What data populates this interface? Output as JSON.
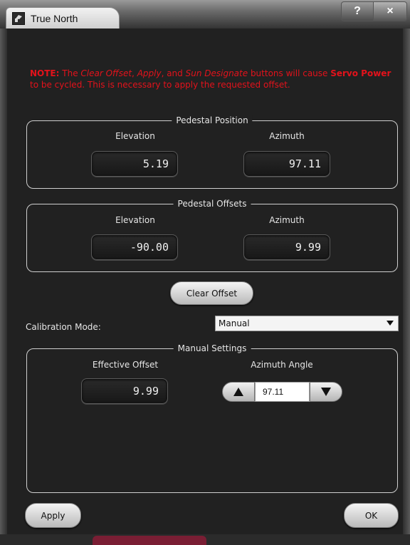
{
  "window": {
    "title": "True North",
    "help_label": "?",
    "close_label": "×",
    "icon": "app-icon"
  },
  "note": {
    "prefix": "NOTE:",
    "text1": " The ",
    "clear_offset": "Clear Offset",
    "comma1": ", ",
    "apply": "Apply",
    "comma_and": ", and ",
    "sun_designate": "Sun Designate",
    "text2": " buttons will cause ",
    "servo_power": "Servo Power",
    "text3": " to be cycled. This is necessary to apply the requested offset.",
    "color": "#e3121b"
  },
  "pedestal_position": {
    "title": "Pedestal Position",
    "elevation_label": "Elevation",
    "azimuth_label": "Azimuth",
    "elevation_value": "5.19",
    "azimuth_value": "97.11"
  },
  "pedestal_offsets": {
    "title": "Pedestal Offsets",
    "elevation_label": "Elevation",
    "azimuth_label": "Azimuth",
    "elevation_value": "-90.00",
    "azimuth_value": "9.99"
  },
  "clear_offset_button": "Clear Offset",
  "calibration": {
    "label": "Calibration Mode:",
    "selected": "Manual"
  },
  "manual_settings": {
    "title": "Manual Settings",
    "effective_offset_label": "Effective Offset",
    "effective_offset_value": "9.99",
    "azimuth_angle_label": "Azimuth Angle",
    "azimuth_angle_value": "97.11"
  },
  "buttons": {
    "apply": "Apply",
    "ok": "OK"
  }
}
